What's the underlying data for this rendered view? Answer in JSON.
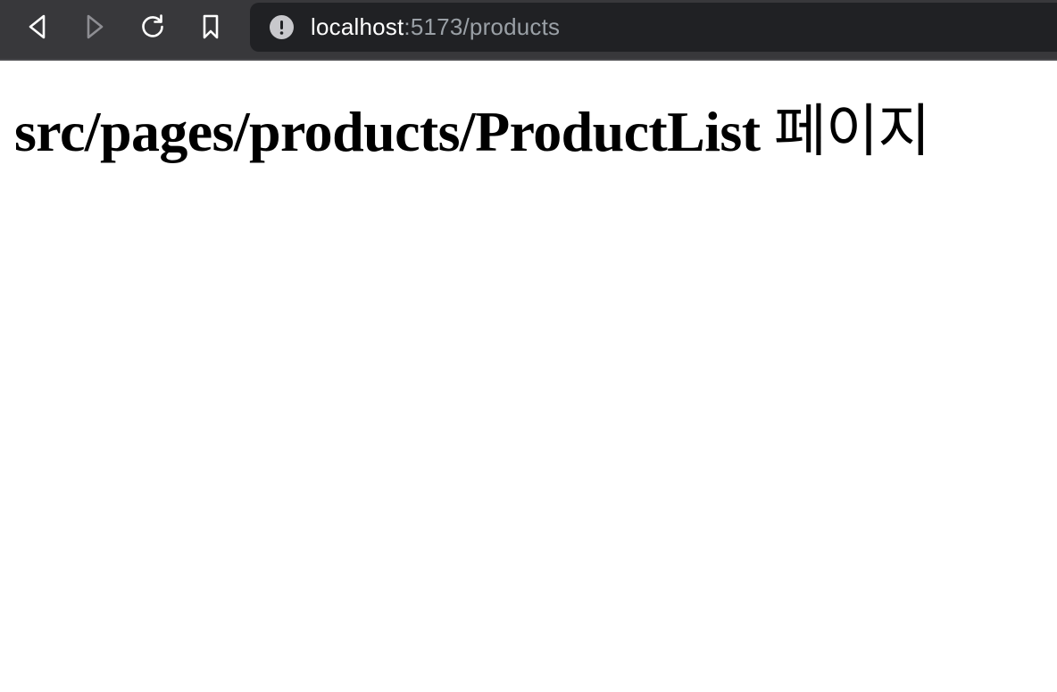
{
  "browser": {
    "nav": {
      "back_icon": "back-arrow-icon",
      "forward_icon": "forward-arrow-icon",
      "reload_icon": "reload-icon",
      "bookmark_icon": "bookmark-icon"
    },
    "address_bar": {
      "site_info_icon": "info-warning-icon",
      "url_host": "localhost",
      "url_rest": ":5173/products"
    },
    "colors": {
      "toolbar_bg": "#38383b",
      "address_bg": "#202124",
      "icon_color": "#ffffff",
      "icon_disabled": "#8e8e93",
      "url_host_color": "#ffffff",
      "url_rest_color": "#9aa0a6"
    }
  },
  "page": {
    "heading": "src/pages/products/ProductList",
    "heading_suffix": "페이지"
  }
}
